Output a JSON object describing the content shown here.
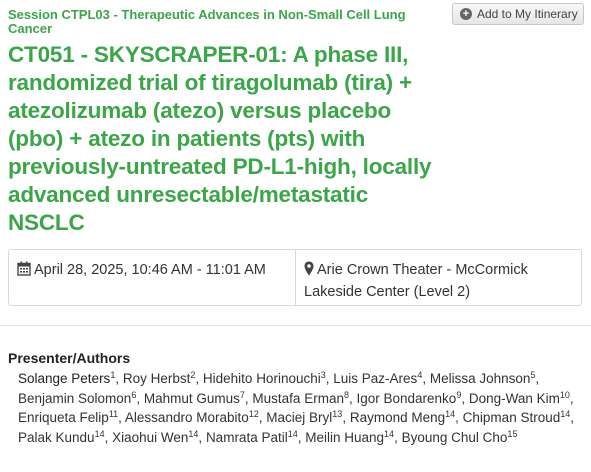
{
  "session": {
    "title": "Session CTPL03 - Therapeutic Advances in Non-Small Cell Lung Cancer"
  },
  "itinerary_button": {
    "label": "Add to My Itinerary"
  },
  "abstract": {
    "title": "CT051 - SKYSCRAPER-01: A phase III, randomized trial of tiragolumab (tira) + atezolizumab (atezo) versus placebo (pbo) + atezo in patients (pts) with previously-untreated PD-L1-high, locally advanced unresectable/metastatic NSCLC"
  },
  "details": {
    "datetime": "April 28, 2025, 10:46 AM - 11:01 AM",
    "location": "Arie Crown Theater - McCormick Lakeside Center (Level 2)"
  },
  "presenters": {
    "label": "Presenter/Authors",
    "authors": [
      {
        "name": "Solange Peters",
        "sup": "1"
      },
      {
        "name": "Roy Herbst",
        "sup": "2"
      },
      {
        "name": "Hidehito Horinouchi",
        "sup": "3"
      },
      {
        "name": "Luis Paz-Ares",
        "sup": "4"
      },
      {
        "name": "Melissa Johnson",
        "sup": "5"
      },
      {
        "name": "Benjamin Solomon",
        "sup": "6"
      },
      {
        "name": "Mahmut Gumus",
        "sup": "7"
      },
      {
        "name": "Mustafa Erman",
        "sup": "8"
      },
      {
        "name": "Igor Bondarenko",
        "sup": "9"
      },
      {
        "name": "Dong-Wan Kim",
        "sup": "10"
      },
      {
        "name": "Enriqueta Felip",
        "sup": "11"
      },
      {
        "name": "Alessandro Morabito",
        "sup": "12"
      },
      {
        "name": "Maciej Bryl",
        "sup": "13"
      },
      {
        "name": "Raymond Meng",
        "sup": "14"
      },
      {
        "name": "Chipman Stroud",
        "sup": "14"
      },
      {
        "name": "Palak Kundu",
        "sup": "14"
      },
      {
        "name": "Xiaohui Wen",
        "sup": "14"
      },
      {
        "name": "Namrata Patil",
        "sup": "14"
      },
      {
        "name": "Meilin Huang",
        "sup": "14"
      },
      {
        "name": "Byoung Chul Cho",
        "sup": "15"
      }
    ]
  },
  "icons": {
    "plus": "plus-circle-icon",
    "date": "calendar-icon",
    "location": "map-marker-icon"
  },
  "colors": {
    "accent_green": "#3aa648"
  }
}
